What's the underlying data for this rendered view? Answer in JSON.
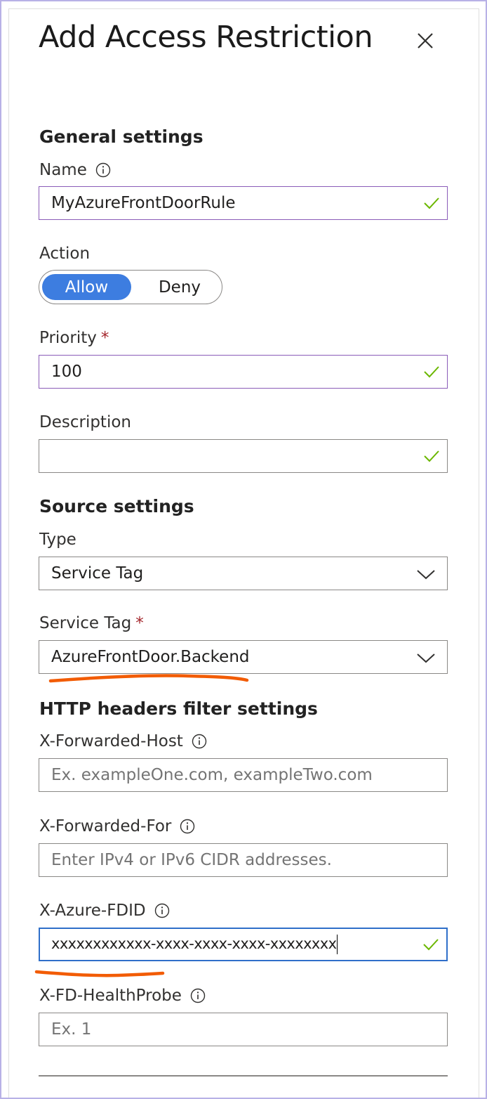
{
  "dialog": {
    "title": "Add Access Restriction",
    "close_icon": "close-icon"
  },
  "general": {
    "heading": "General settings",
    "name_label": "Name",
    "name_value": "MyAzureFrontDoorRule",
    "action_label": "Action",
    "action_options": [
      "Allow",
      "Deny"
    ],
    "action_selected": "Allow",
    "priority_label": "Priority",
    "priority_required": "*",
    "priority_value": "100",
    "description_label": "Description",
    "description_value": ""
  },
  "source": {
    "heading": "Source settings",
    "type_label": "Type",
    "type_value": "Service Tag",
    "service_tag_label": "Service Tag",
    "service_tag_required": "*",
    "service_tag_value": "AzureFrontDoor.Backend"
  },
  "headers": {
    "heading": "HTTP headers filter settings",
    "forwarded_host_label": "X-Forwarded-Host",
    "forwarded_host_placeholder": "Ex. exampleOne.com, exampleTwo.com",
    "forwarded_for_label": "X-Forwarded-For",
    "forwarded_for_placeholder": "Enter IPv4 or IPv6 CIDR addresses.",
    "fdid_label": "X-Azure-FDID",
    "fdid_value": "xxxxxxxxxxxx-xxxx-xxxx-xxxx-xxxxxxxx",
    "healthprobe_label": "X-FD-HealthProbe",
    "healthprobe_placeholder": "Ex. 1"
  },
  "colors": {
    "accent": "#3d7de0",
    "valid_check": "#6bb700",
    "required": "#a4262c",
    "annotation": "#f25c05"
  }
}
